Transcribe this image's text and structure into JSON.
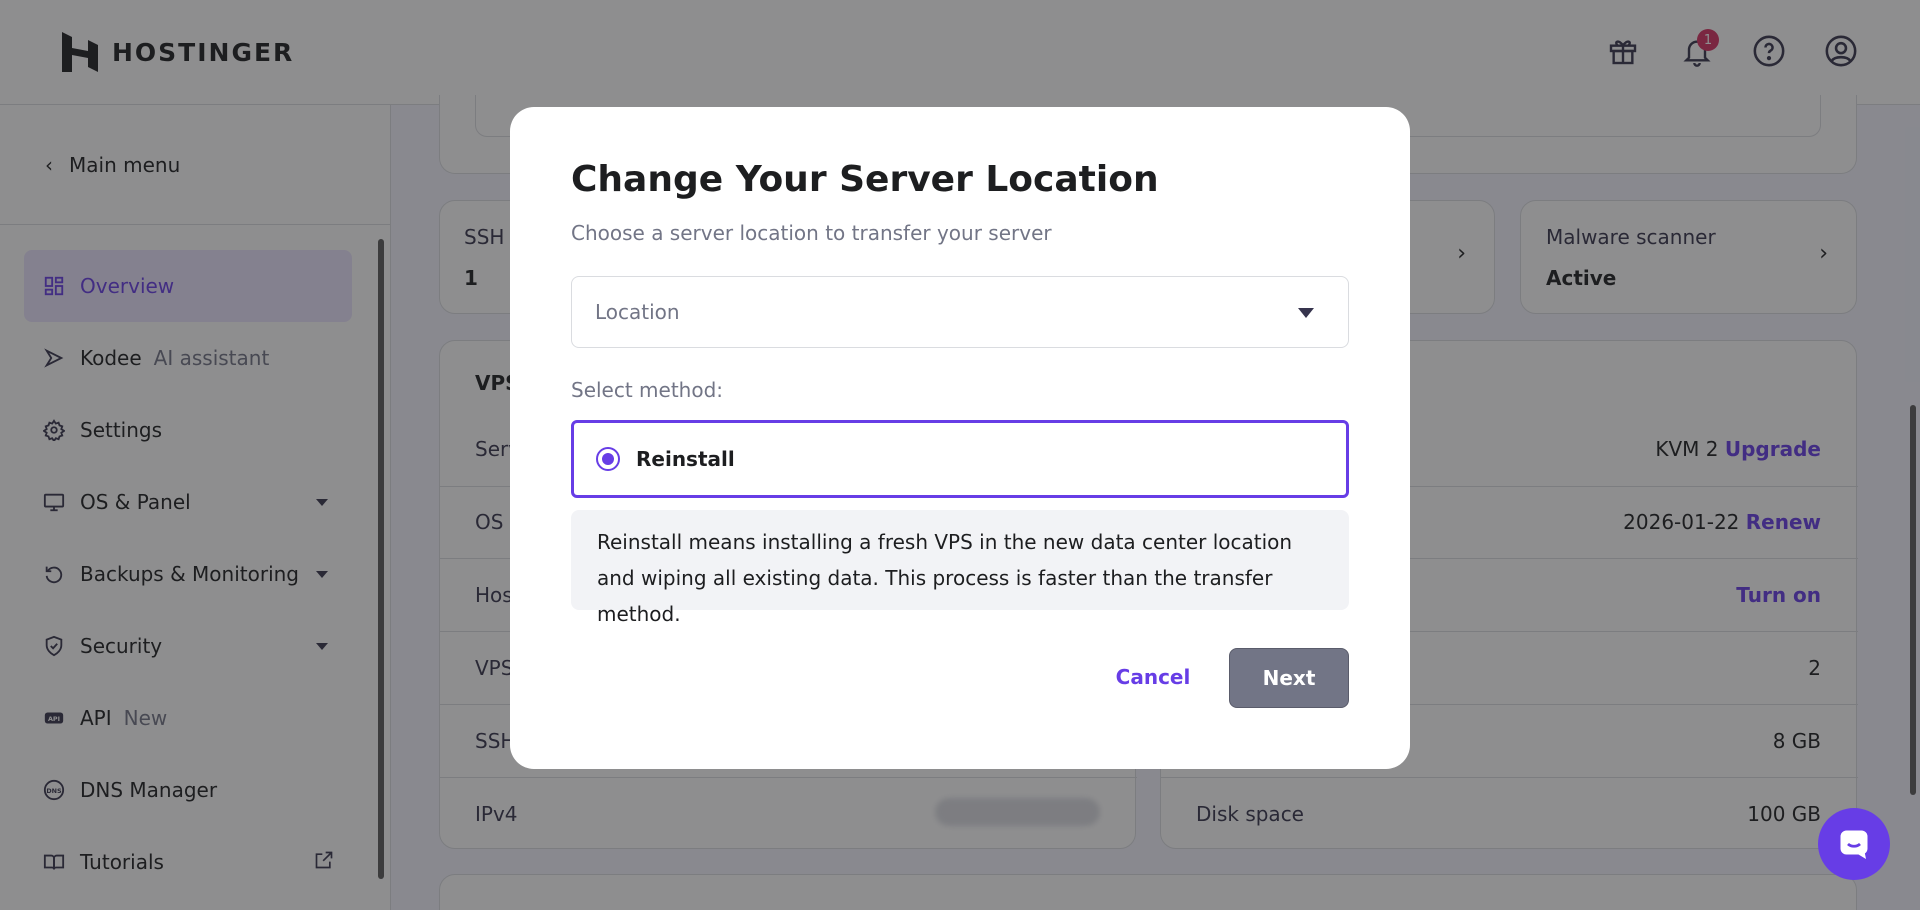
{
  "brand": {
    "name": "HOSTINGER"
  },
  "header": {
    "notification_count": "1"
  },
  "sidebar": {
    "main_menu": "Main menu",
    "items": [
      {
        "label": "Overview",
        "sub": "",
        "icon": "grid-icon"
      },
      {
        "label": "Kodee",
        "sub": "AI assistant",
        "icon": "kodee-icon"
      },
      {
        "label": "Settings",
        "sub": "",
        "icon": "gear-icon"
      },
      {
        "label": "OS & Panel",
        "sub": "",
        "icon": "monitor-icon"
      },
      {
        "label": "Backups & Monitoring",
        "sub": "",
        "icon": "restore-icon"
      },
      {
        "label": "Security",
        "sub": "",
        "icon": "shield-icon"
      },
      {
        "label": "API",
        "sub": "New",
        "icon": "api-icon"
      },
      {
        "label": "DNS Manager",
        "sub": "",
        "icon": "dns-icon"
      },
      {
        "label": "Tutorials",
        "sub": "",
        "icon": "book-icon"
      }
    ]
  },
  "background": {
    "ssh_label": "SSH k",
    "ssh_value": "1",
    "malware_label": "Malware scanner",
    "malware_value": "Active",
    "vps_title": "VPS",
    "left_rows": [
      "Serv",
      "OS",
      "Hos",
      "VPS",
      "SSH",
      "IPv4"
    ],
    "right_rows": [
      {
        "label": "",
        "value": "KVM 2",
        "link": "Upgrade"
      },
      {
        "label": "",
        "value": "2026-01-22",
        "link": "Renew"
      },
      {
        "label": "",
        "value": "",
        "link": "Turn on"
      },
      {
        "label": "",
        "value": "2",
        "link": ""
      },
      {
        "label": "",
        "value": "8 GB",
        "link": ""
      },
      {
        "label": "Disk space",
        "value": "100 GB",
        "link": ""
      }
    ]
  },
  "modal": {
    "title": "Change Your Server Location",
    "subtitle": "Choose a server location to transfer your server",
    "location_placeholder": "Location",
    "method_label": "Select method:",
    "method_option": "Reinstall",
    "info": "Reinstall means installing a fresh VPS in the new data center location and wiping all existing data. This process is faster than the transfer method.",
    "cancel_label": "Cancel",
    "next_label": "Next"
  },
  "colors": {
    "accent": "#673de6",
    "active_bg": "#ebe4ff",
    "disabled_btn": "#727586"
  }
}
